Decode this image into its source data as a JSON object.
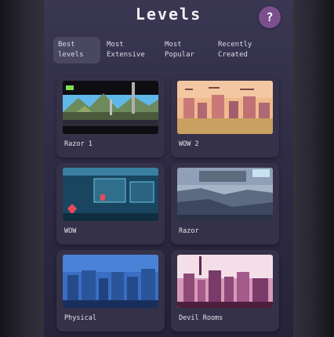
{
  "header": {
    "title": "Levels",
    "help_label": "?"
  },
  "tabs": [
    {
      "label": "Best levels",
      "active": true
    },
    {
      "label": "Most Extensive",
      "active": false
    },
    {
      "label": "Most Popular",
      "active": false
    },
    {
      "label": "Recently Created",
      "active": false
    }
  ],
  "levels": [
    {
      "name": "Razor 1"
    },
    {
      "name": "WOW 2"
    },
    {
      "name": "WOW"
    },
    {
      "name": "Razor"
    },
    {
      "name": "Physical"
    },
    {
      "name": "Devil Rooms"
    }
  ],
  "colors": {
    "panel": "#2e2b44",
    "card": "#353148",
    "active_tab": "#4a4763",
    "help_button": "#7b4f8e"
  }
}
